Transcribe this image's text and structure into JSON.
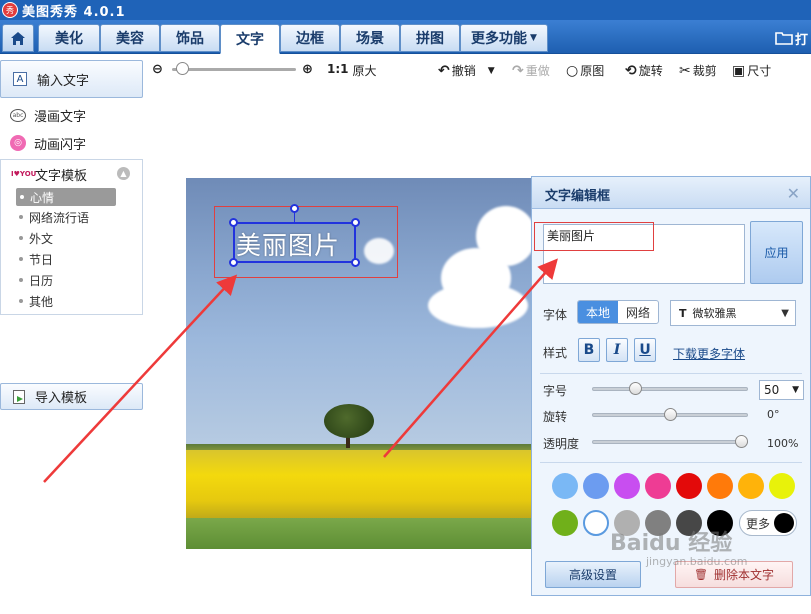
{
  "app": {
    "title": "美图秀秀 4.0.1",
    "logo_text": "秀"
  },
  "nav": {
    "tabs": [
      "美化",
      "美容",
      "饰品",
      "文字",
      "边框",
      "场景",
      "拼图"
    ],
    "active_tab": "文字",
    "more_label": "更多功能",
    "open_label": "打"
  },
  "sidebar": {
    "input_text": "输入文字",
    "items": [
      {
        "label": "漫画文字",
        "icon": "comic-bubble-icon"
      },
      {
        "label": "动画闪字",
        "icon": "flash-text-icon"
      }
    ],
    "template_header": "文字模板",
    "template_icon_text": "I♥YOU",
    "templates": [
      "心情",
      "网络流行语",
      "外文",
      "节日",
      "日历",
      "其他"
    ],
    "selected_template": "心情",
    "import_label": "导入模板"
  },
  "toolbar": {
    "zoom_level": 0.02,
    "original_size_label": "1:1",
    "original_size_text": "原大",
    "undo": "撤销",
    "redo": "重做",
    "original_image": "原图",
    "rotate": "旋转",
    "crop": "裁剪",
    "resize": "尺寸"
  },
  "canvas": {
    "sticker_text": "美丽图片"
  },
  "dialog": {
    "title": "文字编辑框",
    "text_value": "美丽图片",
    "apply": "应用",
    "font_label": "字体",
    "font_source_local": "本地",
    "font_source_web": "网络",
    "font_name": "微软雅黑",
    "style_label": "样式",
    "style_bold": "B",
    "style_italic": "I",
    "style_underline": "U",
    "download_fonts": "下载更多字体",
    "size_label": "字号",
    "size_value": "50",
    "size_level": 0.26,
    "rotate_label": "旋转",
    "rotate_value": "0°",
    "rotate_level": 0.5,
    "opacity_label": "透明度",
    "opacity_value": "100%",
    "opacity_level": 1.0,
    "colors_row1": [
      "#7ab8f5",
      "#6c9cf0",
      "#c84ef0",
      "#ee3c94",
      "#e30a0a",
      "#ff7a0a",
      "#ffb30a",
      "#e8f20a"
    ],
    "colors_row2": [
      "#70b01a",
      "#ffffff",
      "#b0b0b0",
      "#808080",
      "#474747",
      "#000000"
    ],
    "selected_color": "#ffffff",
    "more_colors": "更多",
    "advanced": "高级设置",
    "delete_text": "删除本文字"
  },
  "watermark": {
    "text": "Baidu 经验",
    "sub": "jingyan.baidu.com"
  }
}
